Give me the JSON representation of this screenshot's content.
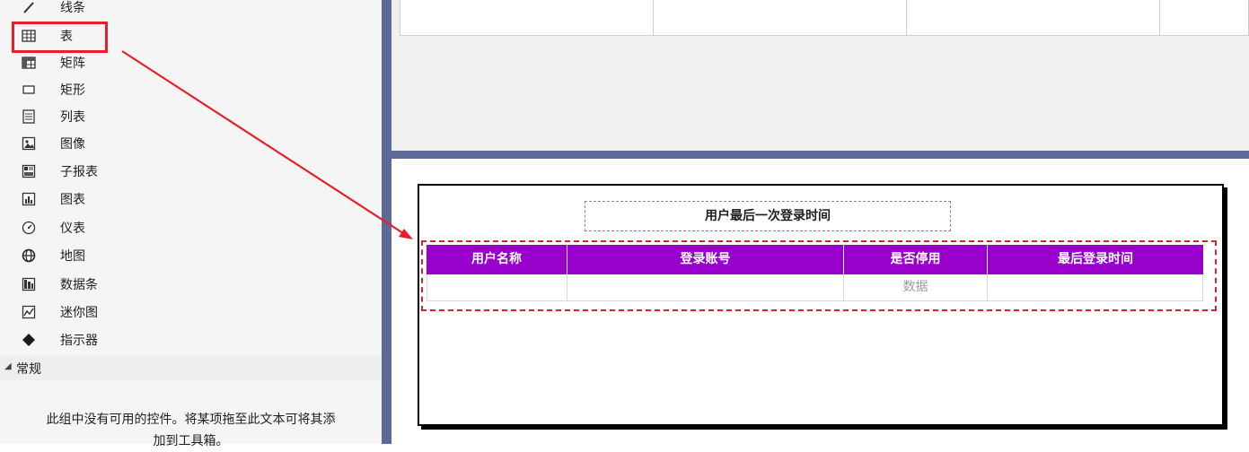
{
  "toolbox": {
    "items": [
      {
        "label": "线条",
        "icon": "line-icon"
      },
      {
        "label": "表",
        "icon": "table-icon"
      },
      {
        "label": "矩阵",
        "icon": "matrix-icon"
      },
      {
        "label": "矩形",
        "icon": "rectangle-icon"
      },
      {
        "label": "列表",
        "icon": "list-icon"
      },
      {
        "label": "图像",
        "icon": "image-icon"
      },
      {
        "label": "子报表",
        "icon": "subreport-icon"
      },
      {
        "label": "图表",
        "icon": "chart-icon"
      },
      {
        "label": "仪表",
        "icon": "gauge-icon"
      },
      {
        "label": "地图",
        "icon": "map-icon"
      },
      {
        "label": "数据条",
        "icon": "databar-icon"
      },
      {
        "label": "迷你图",
        "icon": "sparkline-icon"
      },
      {
        "label": "指示器",
        "icon": "indicator-icon"
      }
    ],
    "general_header": "常规",
    "empty_message_line1": "此组中没有可用的控件。将某项拖至此文本可将其添",
    "empty_message_line2": "加到工具箱。"
  },
  "report": {
    "title": "用户最后一次登录时间",
    "columns": [
      "用户名称",
      "登录账号",
      "是否停用",
      "最后登录时间"
    ],
    "row": [
      "",
      "",
      "数据",
      ""
    ]
  },
  "colors": {
    "header_bg": "#9900cc",
    "highlight": "#e6202b",
    "divider": "#5d6a98"
  }
}
